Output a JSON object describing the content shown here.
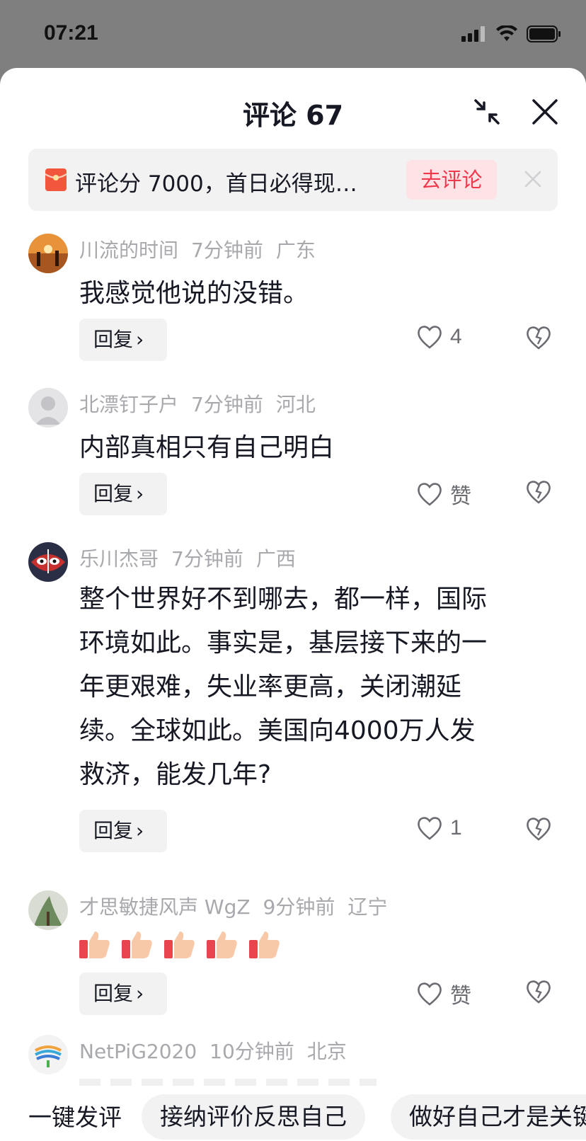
{
  "status": {
    "time": "07:21"
  },
  "sheet": {
    "title": "评论 67"
  },
  "promo": {
    "text": "评论分 7000，首日必得现…",
    "button": "去评论"
  },
  "comments": [
    {
      "user": "川流的时间",
      "time": "7分钟前",
      "location": "广东",
      "text": "我感觉他说的没错。",
      "reply": "回复",
      "likes": "4"
    },
    {
      "user": "北漂钉子户",
      "time": "7分钟前",
      "location": "河北",
      "text": "内部真相只有自己明白",
      "reply": "回复",
      "likes": "赞"
    },
    {
      "user": "乐川杰哥",
      "time": "7分钟前",
      "location": "广西",
      "lines": [
        "整个世界好不到哪去，都一样，国际",
        "环境如此。事实是，基层接下来的一",
        "年更艰难，失业率更高，关闭潮延",
        "续。全球如此。美国向4000万人发",
        "救济，能发几年?"
      ],
      "reply": "回复",
      "likes": "1"
    },
    {
      "user": "才思敏捷风声 WgZ",
      "time": "9分钟前",
      "location": "辽宁",
      "emoji": "thumbs-up",
      "emoji_count": 5,
      "reply": "回复",
      "likes": "赞"
    },
    {
      "user": "NetPiG2020",
      "time": "10分钟前",
      "location": "北京"
    }
  ],
  "quick_reply": {
    "label": "一键发评",
    "chips": [
      "接纳评价反思自己",
      "做好自己才是关键"
    ]
  },
  "colors": {
    "accent": "#ee3a4c",
    "secondary_text": "#a8a9ad",
    "chip_bg": "#f2f2f3"
  }
}
